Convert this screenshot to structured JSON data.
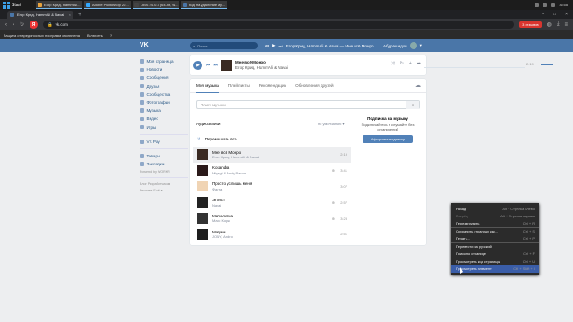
{
  "taskbar": {
    "start_label": "Start",
    "tasks": [
      {
        "label": "Егор Крид, HammAli...",
        "color": "#e8a33d"
      },
      {
        "label": "Adobe Photoshop 20...",
        "color": "#31a8ff"
      },
      {
        "label": "OBS 24.0.3 (64-bit, wi...",
        "color": "#444444"
      },
      {
        "label": "Код на удаление му...",
        "color": "#4a76a8"
      }
    ],
    "time": "16:55"
  },
  "browser": {
    "tabs": [
      {
        "label": "Егор Крид, HammAli & Navai",
        "active": true
      },
      {
        "label": "",
        "active": false
      }
    ],
    "new_tab": "+",
    "url": "vk.com",
    "rating_label": "3 отзывов",
    "notification": "Защита от вредоносных программ отключена",
    "notification_action": "Включить",
    "notification_help": "?"
  },
  "vk": {
    "logo": "VK",
    "search_placeholder": "Поиск",
    "header_track": "Егор Крид, HammAli & Navai — Мне всё Монро",
    "user_name": "Абдрашидов",
    "sidebar": [
      "Моя страница",
      "Новости",
      "Сообщения",
      "Друзья",
      "Сообщества",
      "Фотографии",
      "Музыка",
      "Видео",
      "Игры"
    ],
    "sidebar2": [
      "VK Pay"
    ],
    "sidebar3": [
      "Товары",
      "Закладки"
    ],
    "powered": "Powered by WORKR",
    "footer1": "Блог   Разработчикам",
    "footer2": "Реклама   Ещё ▾",
    "player": {
      "title": "Мне всё Монро",
      "artist": "Егор Крид, HammAli & Navai",
      "time": "2:19"
    },
    "tabs": [
      "Моя музыка",
      "Плейлисты",
      "Рекомендации",
      "Обновления друзей"
    ],
    "music_search": "Поиск музыки",
    "audio_header": "Аудиозаписи",
    "sort": "по умолчанию ▾",
    "shuffle": "Перемешать все",
    "tracks": [
      {
        "title": "Мне всё Монро",
        "artist": "Егор Крид, HammAli & Navai",
        "duration": "2:19",
        "hq": "",
        "color": "#3a2a22"
      },
      {
        "title": "Kosandra",
        "artist": "Miyagi & Andy Panda",
        "duration": "3:41",
        "hq": "⊕",
        "color": "#2b1a1a"
      },
      {
        "title": "Просто услышь меня",
        "artist": "Фаста",
        "duration": "3:07",
        "hq": "",
        "color": "#f0d4b4"
      },
      {
        "title": "Эгоист",
        "artist": "Navai",
        "duration": "2:57",
        "hq": "⊕",
        "color": "#222222"
      },
      {
        "title": "Малолетка",
        "artist": "Макс Корж",
        "duration": "3:23",
        "hq": "⊕",
        "color": "#333333"
      },
      {
        "title": "Мадам",
        "artist": "JONY, Andro",
        "duration": "2:51",
        "hq": "",
        "color": "#1e1e1e"
      }
    ],
    "promo": {
      "title": "Подписка на музыку",
      "text": "Подключайтесь и слушайте без ограничений",
      "button": "Оформить подписку"
    }
  },
  "context_menu": [
    {
      "label": "Назад",
      "key": "Alt + Стрелка влево",
      "state": ""
    },
    {
      "label": "Вперёд",
      "key": "Alt + Стрелка вправо",
      "state": "dis"
    },
    {
      "label": "Перезагрузить",
      "key": "Ctrl + R",
      "state": ""
    },
    {
      "label": "Сохранить страницу как...",
      "key": "Ctrl + S",
      "state": "sep"
    },
    {
      "label": "Печать...",
      "key": "Ctrl + P",
      "state": ""
    },
    {
      "label": "Перевести на русский",
      "key": "",
      "state": "sep"
    },
    {
      "label": "Поиск по странице",
      "key": "Ctrl + F",
      "state": ""
    },
    {
      "label": "Просмотреть код страницы",
      "key": "Ctrl + U",
      "state": "sep"
    },
    {
      "label": "Просмотреть элемент",
      "key": "Ctrl + Shift + I",
      "state": "hl"
    }
  ]
}
